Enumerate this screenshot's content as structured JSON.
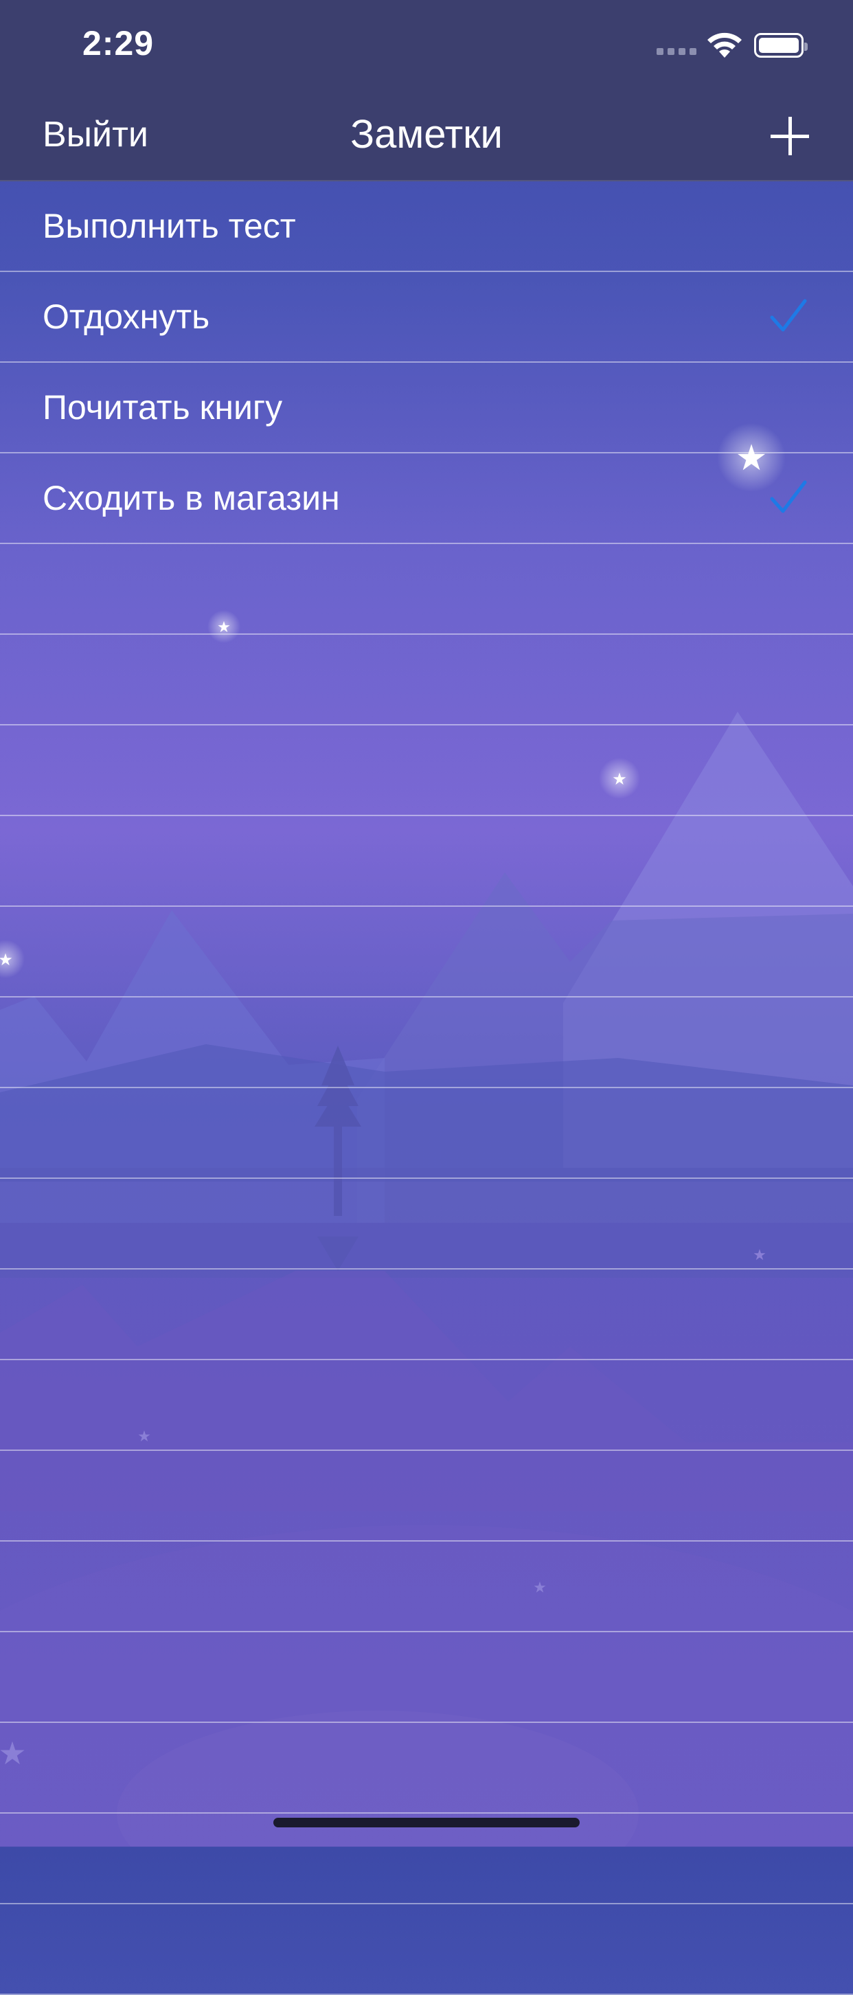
{
  "status_bar": {
    "time": "2:29"
  },
  "nav": {
    "left_button": "Выйти",
    "title": "Заметки",
    "add_icon": "plus-icon"
  },
  "notes": [
    {
      "text": "Выполнить тест",
      "checked": false
    },
    {
      "text": "Отдохнуть",
      "checked": true
    },
    {
      "text": "Почитать книгу",
      "checked": false
    },
    {
      "text": "Сходить в магазин",
      "checked": true
    },
    {
      "text": "",
      "checked": false
    },
    {
      "text": "",
      "checked": false
    },
    {
      "text": "",
      "checked": false
    },
    {
      "text": "",
      "checked": false
    },
    {
      "text": "",
      "checked": false
    },
    {
      "text": "",
      "checked": false
    },
    {
      "text": "",
      "checked": false
    },
    {
      "text": "",
      "checked": false
    },
    {
      "text": "",
      "checked": false
    },
    {
      "text": "",
      "checked": false
    },
    {
      "text": "",
      "checked": false
    },
    {
      "text": "",
      "checked": false
    },
    {
      "text": "",
      "checked": false
    },
    {
      "text": "",
      "checked": false
    },
    {
      "text": "",
      "checked": false
    },
    {
      "text": "",
      "checked": false
    }
  ],
  "colors": {
    "nav_background": "#3c3f6e",
    "checkmark": "#1e7ae6",
    "background_top": "#3d4aa8",
    "background_bottom": "#6a5cc4"
  },
  "icons": {
    "check": "checkmark-icon",
    "wifi": "wifi-icon",
    "battery": "battery-icon"
  }
}
